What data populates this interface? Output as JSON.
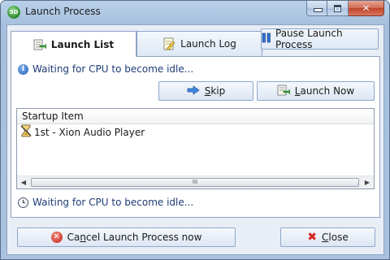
{
  "window": {
    "title": "Launch Process",
    "app_icon_text": "SD"
  },
  "tabs": [
    {
      "label": "Launch List",
      "icon": "launch-list-icon",
      "active": true
    },
    {
      "label": "Launch Log",
      "icon": "log-icon",
      "active": false
    }
  ],
  "pause_button": {
    "label": "Pause Launch Process",
    "icon": "pause-icon"
  },
  "panel": {
    "status_top": "Waiting for CPU to become idle...",
    "skip_prefix": "",
    "skip_underlined": "S",
    "skip_rest": "kip",
    "launch_now_underlined": "L",
    "launch_now_rest": "aunch Now",
    "list": {
      "column_header": "Startup Item",
      "rows": [
        {
          "label": "1st - Xion Audio Player",
          "icon": "hourglass-icon"
        }
      ],
      "scroll_thumb_grip": "III"
    },
    "status_bottom": "Waiting for CPU to become idle..."
  },
  "footer": {
    "cancel_prefix": "Ca",
    "cancel_underlined": "n",
    "cancel_rest": "cel Launch Process now",
    "close_underlined": "C",
    "close_rest": "lose"
  },
  "colors": {
    "title_bar": "#b9d1ea",
    "status_text": "#1e3c78",
    "close_caption": "#c0442a",
    "cancel_icon": "#c4231b"
  }
}
